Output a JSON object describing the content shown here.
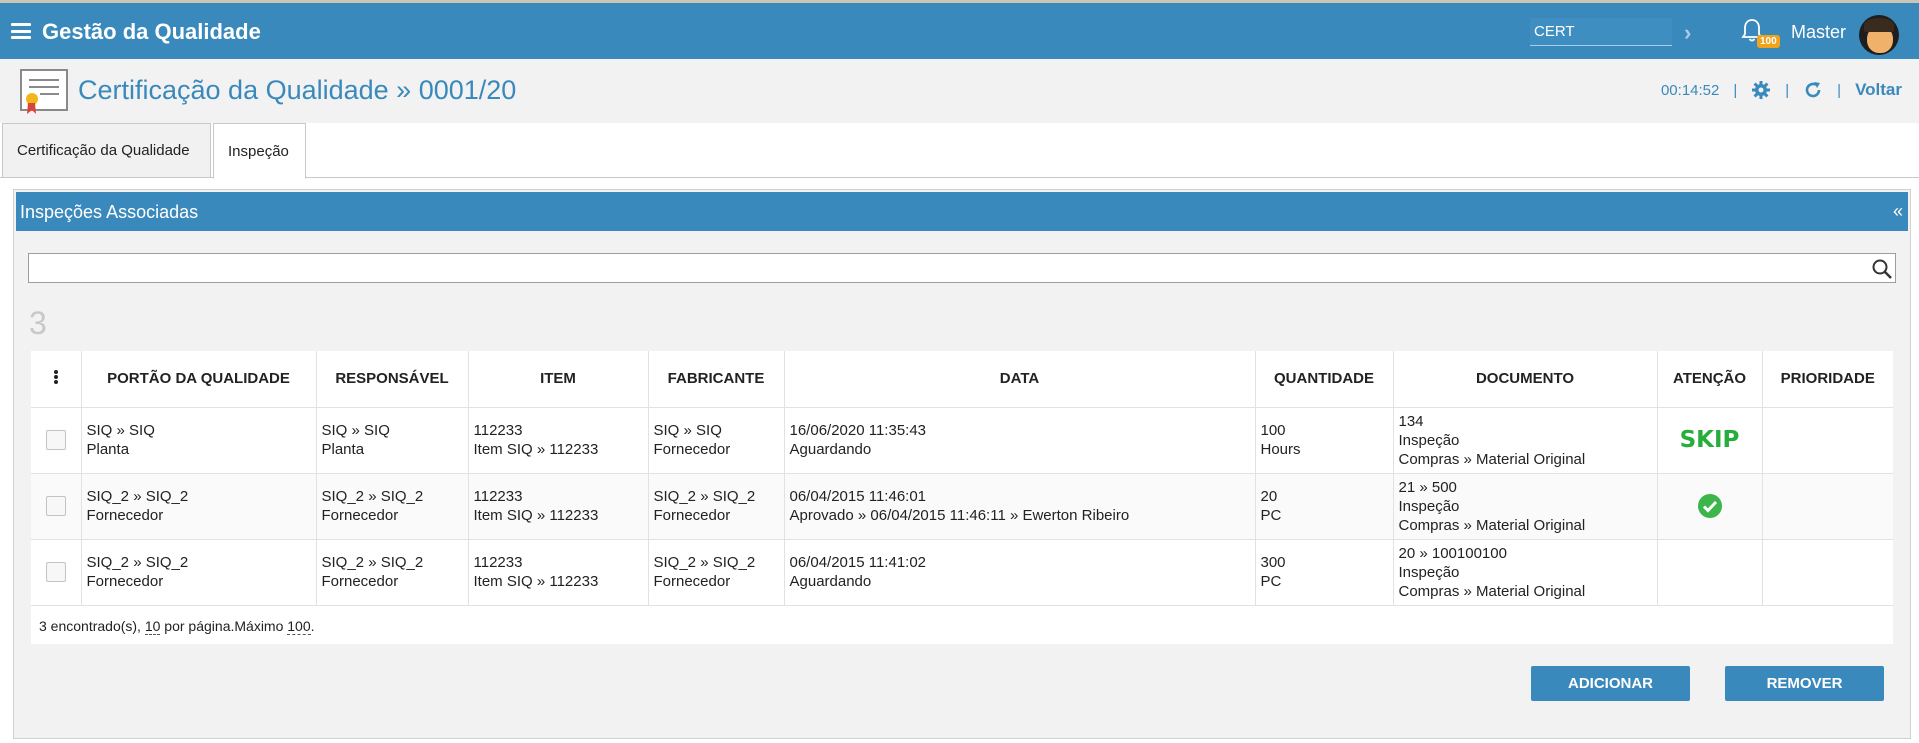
{
  "app": {
    "title": "Gestão da Qualidade"
  },
  "topbar": {
    "search_value": "CERT",
    "notifications_badge": "100",
    "user_name": "Master"
  },
  "page": {
    "title": "Certificação da Qualidade » 0001/20",
    "timer": "00:14:52",
    "back_label": "Voltar"
  },
  "tabs": [
    {
      "label": "Certificação da Qualidade"
    },
    {
      "label": "Inspeção"
    }
  ],
  "panel": {
    "title": "Inspeções Associadas",
    "collapse_label": "«",
    "result_count": "3"
  },
  "table": {
    "headers": [
      "PORTÃO DA QUALIDADE",
      "RESPONSÁVEL",
      "ITEM",
      "FABRICANTE",
      "DATA",
      "QUANTIDADE",
      "DOCUMENTO",
      "ATENÇÃO",
      "PRIORIDADE"
    ],
    "rows": [
      {
        "portao": [
          "SIQ » SIQ",
          "Planta"
        ],
        "responsavel": [
          "SIQ » SIQ",
          "Planta"
        ],
        "item": [
          "112233",
          "Item SIQ » 112233"
        ],
        "fabricante": [
          "SIQ » SIQ",
          "Fornecedor"
        ],
        "data": [
          "16/06/2020 11:35:43",
          "Aguardando"
        ],
        "quantidade": [
          "100",
          "Hours"
        ],
        "documento": [
          "134",
          "Inspeção",
          "Compras » Material Original"
        ],
        "atencao": "SKIP"
      },
      {
        "portao": [
          "SIQ_2 » SIQ_2",
          "Fornecedor"
        ],
        "responsavel": [
          "SIQ_2 » SIQ_2",
          "Fornecedor"
        ],
        "item": [
          "112233",
          "Item SIQ » 112233"
        ],
        "fabricante": [
          "SIQ_2 » SIQ_2",
          "Fornecedor"
        ],
        "data": [
          "06/04/2015 11:46:01",
          "Aprovado » 06/04/2015 11:46:11 » Ewerton Ribeiro"
        ],
        "quantidade": [
          "20",
          "PC"
        ],
        "documento": [
          "21 » 500",
          "Inspeção",
          "Compras » Material Original"
        ],
        "atencao": "check-circle-icon"
      },
      {
        "portao": [
          "SIQ_2 » SIQ_2",
          "Fornecedor"
        ],
        "responsavel": [
          "SIQ_2 » SIQ_2",
          "Fornecedor"
        ],
        "item": [
          "112233",
          "Item SIQ » 112233"
        ],
        "fabricante": [
          "SIQ_2 » SIQ_2",
          "Fornecedor"
        ],
        "data": [
          "06/04/2015 11:41:02",
          "Aguardando"
        ],
        "quantidade": [
          "300",
          "PC"
        ],
        "documento": [
          "20 » 100100100",
          "Inspeção",
          "Compras » Material Original"
        ],
        "atencao": ""
      }
    ],
    "footer": {
      "found": "3 encontrado(s), ",
      "per_page": "10",
      "per_page_suffix": " por página.Máximo ",
      "max": "100",
      "end": "."
    }
  },
  "buttons": {
    "add": "ADICIONAR",
    "remove": "REMOVER"
  },
  "colors": {
    "primary": "#3a89bc",
    "skip": "#27ad3c",
    "badge": "#f0a31b"
  }
}
